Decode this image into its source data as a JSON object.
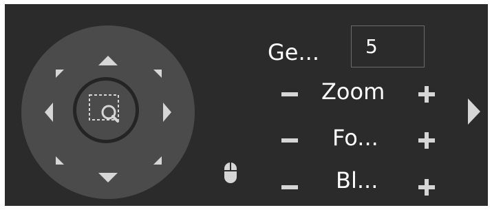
{
  "ptz": {
    "joystick": {
      "up": "arrow-up-icon",
      "down": "arrow-down-icon",
      "left": "arrow-left-icon",
      "right": "arrow-right-icon",
      "up_left": "arrow-up-left-icon",
      "up_right": "arrow-up-right-icon",
      "down_left": "arrow-down-left-icon",
      "down_right": "arrow-down-right-icon",
      "center": "zoom-area-icon"
    },
    "speed": {
      "label": "Ge...",
      "value": "5"
    },
    "zoom": {
      "label": "Zoom"
    },
    "focus": {
      "label": "Fo..."
    },
    "iris": {
      "label": "Bl..."
    },
    "expand_icon": "chevron-right-icon",
    "mouse_icon": "mouse-icon"
  },
  "colors": {
    "panel": "#2b2b2b",
    "joystick": "#4b4b4b",
    "arrows": "#d6d6d6",
    "text": "#ffffff"
  }
}
